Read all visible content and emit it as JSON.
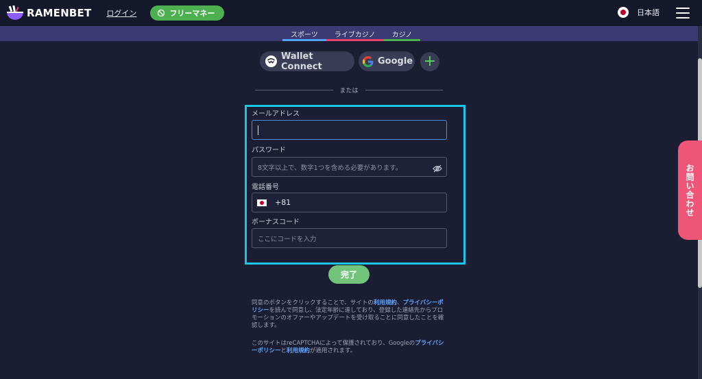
{
  "header": {
    "logo_text": "RAMENBET",
    "login_label": "ログイン",
    "free_money_label": "フリーマネー",
    "language_label": "日本語"
  },
  "tabs": [
    {
      "label": "スポーツ"
    },
    {
      "label": "ライブカジノ"
    },
    {
      "label": "カジノ"
    }
  ],
  "social": {
    "wallet_connect_label": "Wallet Connect",
    "google_label": "Google",
    "more_label": "+"
  },
  "divider_text": "または",
  "form": {
    "email": {
      "label": "メールアドレス",
      "value": ""
    },
    "password": {
      "label": "パスワード",
      "placeholder": "8文字以上で、数字1つを含める必要があります。"
    },
    "phone": {
      "label": "電話番号",
      "country_code": "+81"
    },
    "bonus": {
      "label": "ボーナスコード",
      "placeholder": "ここにコードを入力"
    },
    "submit_label": "完了"
  },
  "legal": {
    "p1_a": "同意のボタンをクリックすることで、サイトの",
    "p1_terms": "利用規約",
    "p1_b": "、",
    "p1_privacy": "プライバシーポリシー",
    "p1_c": "を読んで同意し、法定年齢に達しており、登録した連絡先からプロモーションのオファーやアップデートを受け取ることに同意したことを確認します。",
    "p2_a": "このサイトはreCAPTCHAによって保護されており、Googleの",
    "p2_privacy": "プライバシーポリシー",
    "p2_b": "と",
    "p2_terms": "利用規約",
    "p2_c": "が適用されます。"
  },
  "contact_label": "お問い合わせ",
  "colors": {
    "accent_green": "#4caf50",
    "focus_outline": "#18c6e6",
    "link_blue": "#5aa8ff",
    "contact_pink": "#ee5577"
  }
}
